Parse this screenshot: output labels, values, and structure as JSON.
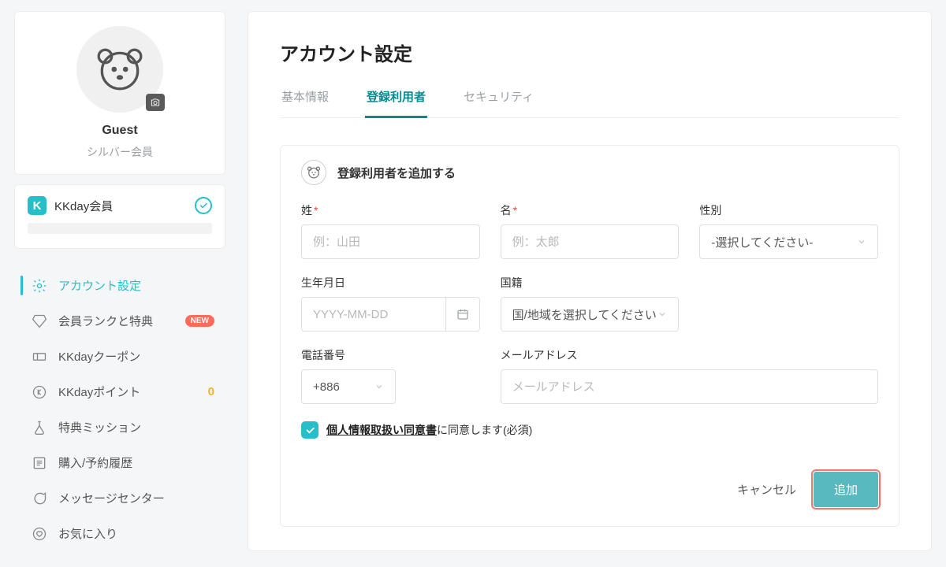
{
  "profile": {
    "name": "Guest",
    "tier": "シルバー会員"
  },
  "member_card": {
    "label": "KKday会員"
  },
  "nav": {
    "items": [
      {
        "label": "アカウント設定"
      },
      {
        "label": "会員ランクと特典",
        "badge_new": "NEW"
      },
      {
        "label": "KKdayクーポン"
      },
      {
        "label": "KKdayポイント",
        "count": "0"
      },
      {
        "label": "特典ミッション"
      },
      {
        "label": "購入/予約履歴"
      },
      {
        "label": "メッセージセンター"
      },
      {
        "label": "お気に入り"
      }
    ]
  },
  "main": {
    "title": "アカウント設定",
    "tabs": [
      "基本情報",
      "登録利用者",
      "セキュリティ"
    ],
    "panel_title": "登録利用者を追加する",
    "fields": {
      "last_name": {
        "label": "姓",
        "placeholder": "例：山田"
      },
      "first_name": {
        "label": "名",
        "placeholder": "例：太郎"
      },
      "gender": {
        "label": "性別",
        "placeholder": "-選択してください-"
      },
      "dob": {
        "label": "生年月日",
        "placeholder": "YYYY-MM-DD"
      },
      "nationality": {
        "label": "国籍",
        "placeholder": "国/地域を選択してください"
      },
      "phone": {
        "label": "電話番号",
        "code": "+886"
      },
      "email": {
        "label": "メールアドレス",
        "placeholder": "メールアドレス"
      }
    },
    "consent": {
      "link": "個人情報取扱い同意書",
      "rest": "に同意します(必須)"
    },
    "actions": {
      "cancel": "キャンセル",
      "add": "追加"
    }
  }
}
